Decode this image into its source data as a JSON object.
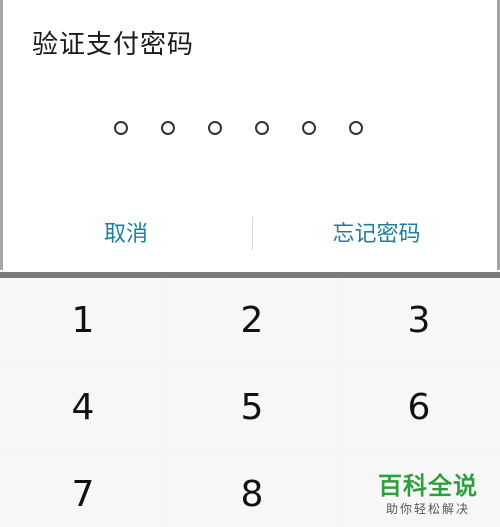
{
  "dialog": {
    "title": "验证支付密码",
    "pin_length": 6,
    "cancel_label": "取消",
    "forgot_label": "忘记密码"
  },
  "keypad": {
    "keys": [
      "1",
      "2",
      "3",
      "4",
      "5",
      "6",
      "7",
      "8",
      ""
    ]
  },
  "watermark": {
    "main": "百科全说",
    "sub": "助你轻松解决"
  },
  "colors": {
    "accent": "#1f7f9a",
    "title_text": "#1a1a1a",
    "watermark_green": "#2e9f3e"
  }
}
